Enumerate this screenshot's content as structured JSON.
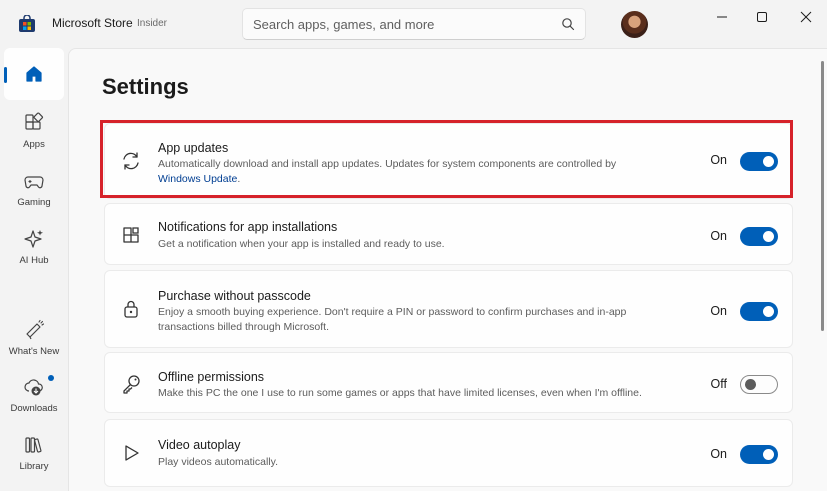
{
  "titlebar": {
    "app_name": "Microsoft Store",
    "channel": "Insider",
    "window_controls": [
      "minimize-icon",
      "maximize-icon",
      "close-icon"
    ]
  },
  "search": {
    "placeholder": "Search apps, games, and more",
    "icon": "search-icon"
  },
  "sidebar": {
    "items": [
      {
        "id": "home",
        "label": "",
        "icon": "home-icon",
        "active": true
      },
      {
        "id": "apps",
        "label": "Apps",
        "icon": "apps-grid-icon"
      },
      {
        "id": "gaming",
        "label": "Gaming",
        "icon": "gamepad-icon"
      },
      {
        "id": "ai-hub",
        "label": "AI Hub",
        "icon": "sparkle-icon"
      },
      {
        "id": "whats-new",
        "label": "What's New",
        "icon": "megaphone-icon"
      },
      {
        "id": "downloads",
        "label": "Downloads",
        "icon": "cloud-download-icon",
        "badge": true
      },
      {
        "id": "library",
        "label": "Library",
        "icon": "library-icon"
      }
    ]
  },
  "page": {
    "title": "Settings"
  },
  "settings": [
    {
      "title": "App updates",
      "description": "Automatically download and install app updates. Updates for system components are controlled by",
      "link": "Windows Update",
      "link_suffix": ".",
      "state": "On",
      "enabled": true,
      "icon": "refresh-icon"
    },
    {
      "title": "Notifications for app installations",
      "description": "Get a notification when your app is installed and ready to use.",
      "state": "On",
      "enabled": true,
      "icon": "app-add-icon"
    },
    {
      "title": "Purchase without passcode",
      "description": "Enjoy a smooth buying experience. Don't require a PIN or password to confirm purchases and in-app transactions billed through Microsoft.",
      "state": "On",
      "enabled": true,
      "icon": "lock-icon"
    },
    {
      "title": "Offline permissions",
      "description": "Make this PC the one I use to run some games or apps that have limited licenses, even when I'm offline.",
      "state": "Off",
      "enabled": false,
      "icon": "key-icon"
    },
    {
      "title": "Video autoplay",
      "description": "Play videos automatically.",
      "state": "On",
      "enabled": true,
      "icon": "play-icon"
    }
  ],
  "colors": {
    "accent": "#005fb8",
    "highlight": "#d6222a"
  }
}
